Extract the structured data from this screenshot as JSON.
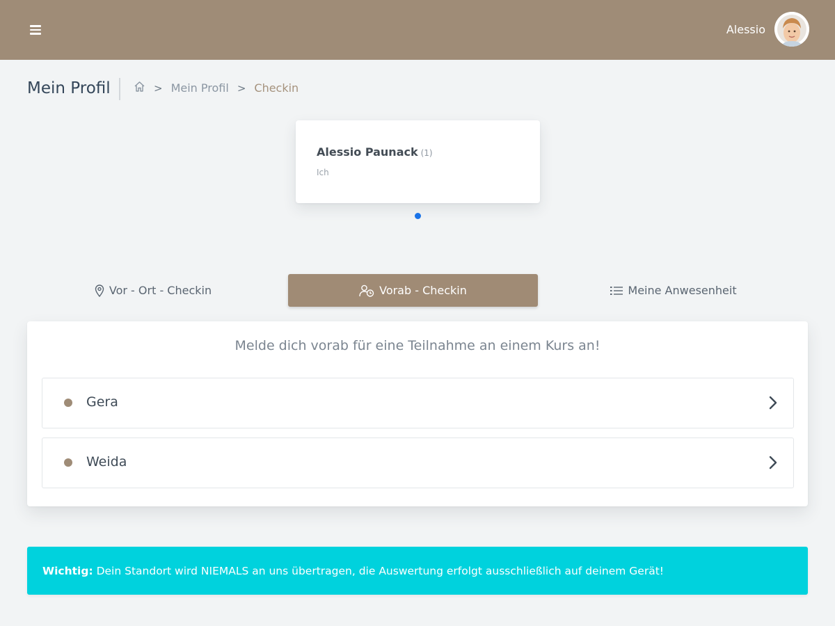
{
  "header": {
    "user_name": "Alessio",
    "menu_icon": "hamburger-menu-icon",
    "colors": {
      "bar": "#9f8c77"
    }
  },
  "breadcrumb": {
    "page_title": "Mein Profil",
    "home_icon": "home-icon",
    "items": [
      "Mein Profil",
      "Checkin"
    ],
    "separator": ">"
  },
  "member_card": {
    "name": "Alessio Paunack",
    "count": "(1)",
    "role": "Ich"
  },
  "tabs": [
    {
      "label": "Vor - Ort - Checkin",
      "icon": "location-pin-icon",
      "active": false
    },
    {
      "label": "Vorab - Checkin",
      "icon": "user-clock-icon",
      "active": true
    },
    {
      "label": "Meine Anwesenheit",
      "icon": "list-icon",
      "active": false
    }
  ],
  "panel": {
    "intro": "Melde dich vorab für eine Teilnahme an einem Kurs an!",
    "courses": [
      {
        "label": "Gera"
      },
      {
        "label": "Weida"
      }
    ]
  },
  "alert": {
    "prefix": "Wichtig:",
    "text": " Dein Standort wird NIEMALS an uns übertragen, die Auswertung erfolgt ausschließlich auf deinem Gerät!",
    "color": "#00d2dd"
  }
}
